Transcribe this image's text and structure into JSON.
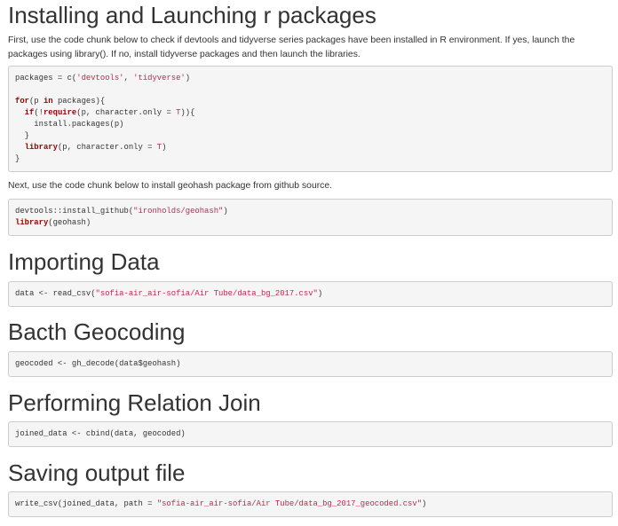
{
  "sections": {
    "installing": {
      "title": "Installing and Launching r packages",
      "intro": "First, use the code chunk below to check if devtools and tidyverse series packages have been installed in R environment. If yes, launch the packages using library(). If no, install tidyverse packages and then launch the libraries.",
      "code": {
        "l1_a": "packages = c(",
        "l1_s1": "'devtools'",
        "l1_b": ", ",
        "l1_s2": "'tidyverse'",
        "l1_c": ")",
        "l3_kw": "for",
        "l3_a": "(p ",
        "l3_kw2": "in",
        "l3_b": " packages){",
        "l4_a": "  ",
        "l4_kw": "if",
        "l4_b": "(!",
        "l4_kw2": "require",
        "l4_c": "(p, character.only = ",
        "l4_t": "T",
        "l4_d": ")){",
        "l5": "    install.packages(p)",
        "l6": "  }",
        "l7_a": "  ",
        "l7_kw": "library",
        "l7_b": "(p, character.only = ",
        "l7_t": "T",
        "l7_c": ")",
        "l8": "}"
      },
      "next_text": "Next, use the code chunk below to install geohash package from github source.",
      "code2": {
        "l1_a": "devtools::install_github(",
        "l1_s": "\"ironholds/geohash\"",
        "l1_b": ")",
        "l2_kw": "library",
        "l2_a": "(geohash)"
      }
    },
    "importing": {
      "title": "Importing Data",
      "code": {
        "a": "data <- read_csv(",
        "s": "\"sofia-air_air-sofia/Air Tube/data_bg_2017.csv\"",
        "b": ")"
      }
    },
    "geocoding": {
      "title": "Bacth Geocoding",
      "code": "geocoded <- gh_decode(data$geohash)"
    },
    "join": {
      "title": "Performing Relation Join",
      "code": "joined_data <- cbind(data, geocoded)"
    },
    "saving": {
      "title": "Saving output file",
      "code": {
        "a": "write_csv(joined_data, path = ",
        "s": "\"sofia-air_air-sofia/Air Tube/data_bg_2017_geocoded.csv\"",
        "b": ")"
      }
    }
  }
}
